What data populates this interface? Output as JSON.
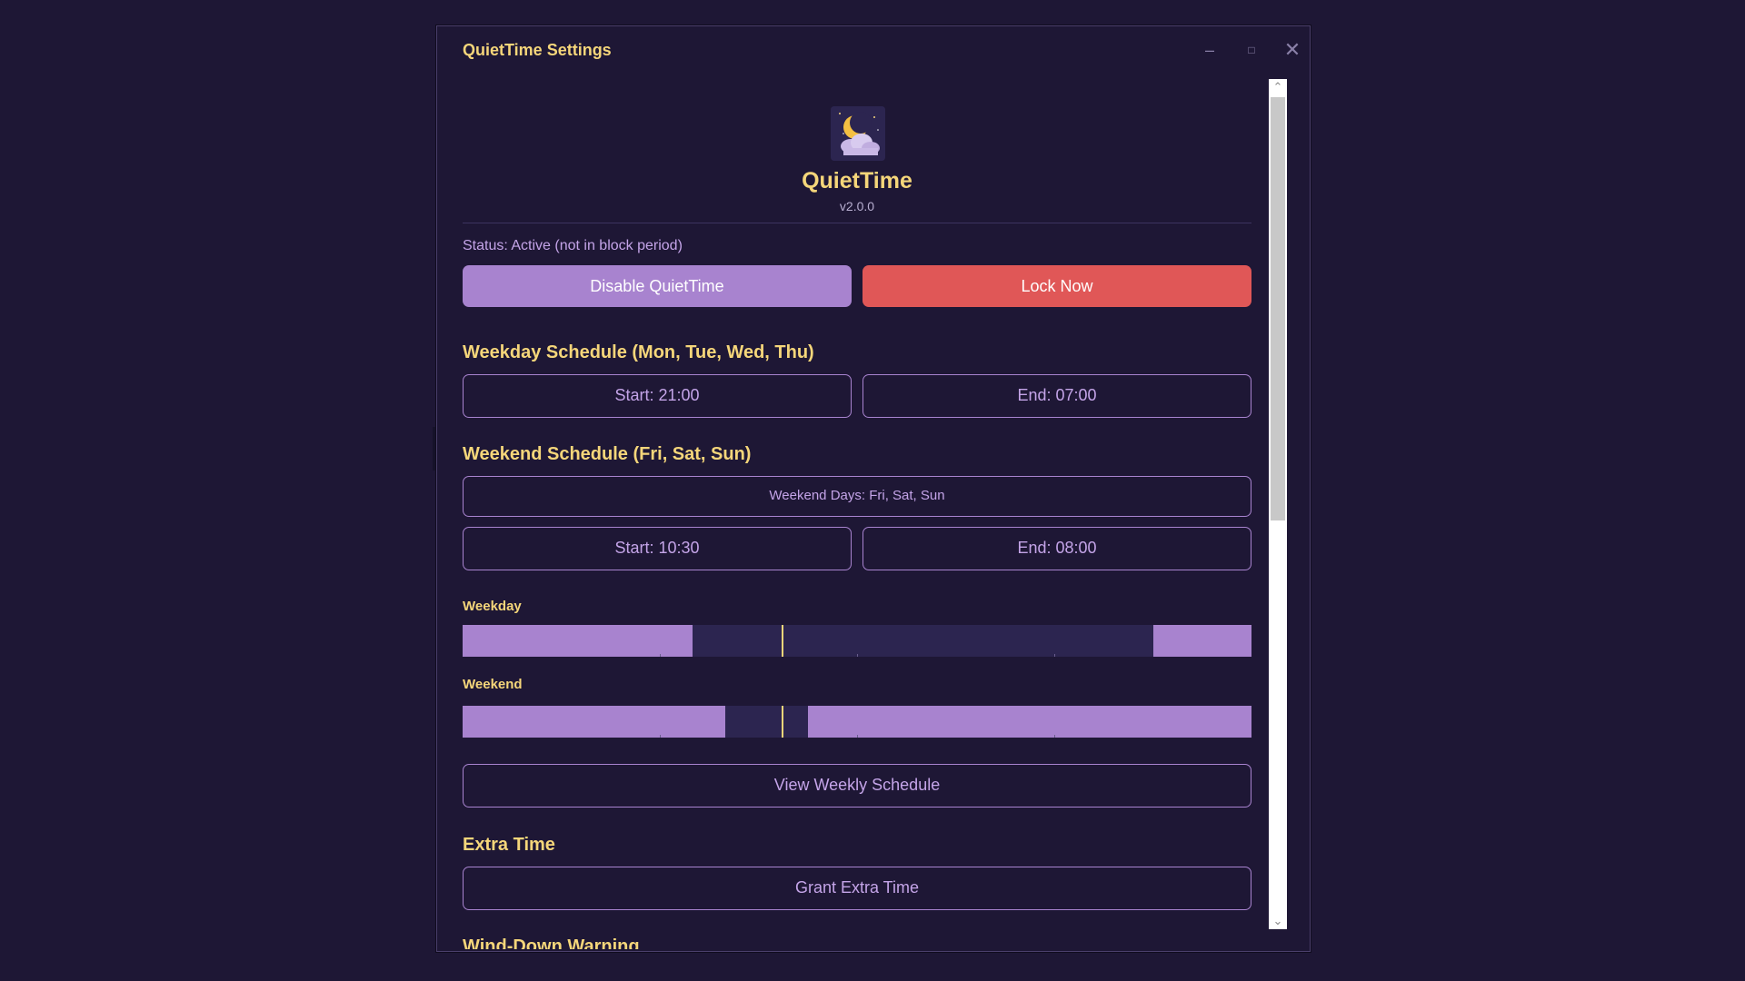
{
  "window": {
    "title": "QuietTime Settings",
    "minimize_icon": "minimize-icon",
    "maximize_icon": "maximize-icon",
    "close_icon": "close-icon"
  },
  "header": {
    "logo_icon": "moon-cloud-logo",
    "app_name": "QuietTime",
    "version": "v2.0.0"
  },
  "status": {
    "text": "Status: Active (not in block period)"
  },
  "actions": {
    "disable_label": "Disable QuietTime",
    "lock_label": "Lock Now"
  },
  "weekday": {
    "title": "Weekday Schedule (Mon, Tue, Wed, Thu)",
    "start_label": "Start: 21:00",
    "end_label": "End: 07:00"
  },
  "weekend": {
    "title": "Weekend Schedule (Fri, Sat, Sun)",
    "days_label": "Weekend Days: Fri, Sat, Sun",
    "start_label": "Start: 10:30",
    "end_label": "End: 08:00"
  },
  "timeline": {
    "weekday_label": "Weekday",
    "weekend_label": "Weekend",
    "weekday_blocks_hours": [
      [
        0,
        7
      ],
      [
        21,
        24
      ]
    ],
    "weekend_blocks_hours": [
      [
        0,
        8
      ],
      [
        10.5,
        24
      ]
    ],
    "now_hour": 9.7
  },
  "view_schedule_label": "View Weekly Schedule",
  "extra": {
    "title": "Extra Time",
    "grant_label": "Grant Extra Time"
  },
  "winddown": {
    "title": "Wind-Down Warning"
  },
  "colors": {
    "background": "#1e1735",
    "accent_purple": "#a883cf",
    "accent_red": "#e05757",
    "heading_gold": "#f5d67a",
    "bar_track": "#2c2550"
  }
}
